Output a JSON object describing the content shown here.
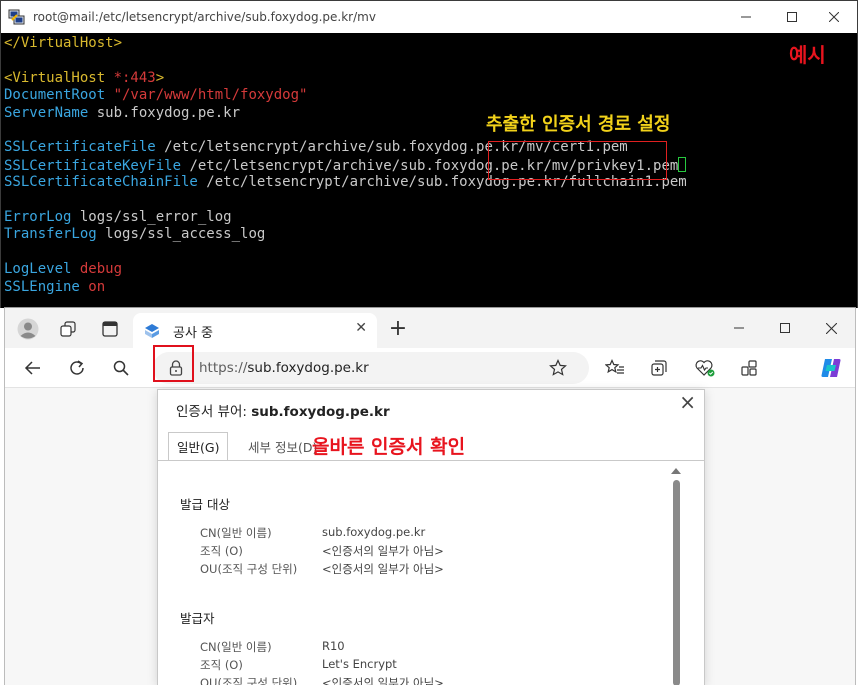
{
  "terminal": {
    "title": "root@mail:/etc/letsencrypt/archive/sub.foxydog.pe.kr/mv",
    "lines": [
      [
        {
          "t": "</VirtualHost>",
          "c": "yellow"
        }
      ],
      [],
      [
        {
          "t": "<VirtualHost ",
          "c": "yellow"
        },
        {
          "t": "*:443",
          "c": "red"
        },
        {
          "t": ">",
          "c": "yellow"
        }
      ],
      [
        {
          "t": "DocumentRoot ",
          "c": "cyan"
        },
        {
          "t": "\"/var/www/html/foxydog\"",
          "c": "red"
        }
      ],
      [
        {
          "t": "ServerName ",
          "c": "cyan"
        },
        {
          "t": "sub.foxydog.pe.kr",
          "c": "white"
        }
      ],
      [],
      [
        {
          "t": "SSLCertificateFile ",
          "c": "cyan"
        },
        {
          "t": "/etc/letsencrypt/archive/sub.foxydog.pe.kr/mv/cert1.pem",
          "c": "white"
        }
      ],
      [
        {
          "t": "SSLCertificateKeyFile ",
          "c": "cyan"
        },
        {
          "t": "/etc/letsencrypt/archive/sub.foxydog.pe.kr/mv/privkey1.pem",
          "c": "white"
        },
        {
          "cursor": true
        }
      ],
      [
        {
          "t": "SSLCertificateChainFile ",
          "c": "cyan"
        },
        {
          "t": "/etc/letsencrypt/archive/sub.foxydog.pe.kr/fullchain1.pem",
          "c": "white"
        }
      ],
      [],
      [
        {
          "t": "ErrorLog ",
          "c": "cyan"
        },
        {
          "t": "logs/ssl_error_log",
          "c": "white"
        }
      ],
      [
        {
          "t": "TransferLog ",
          "c": "cyan"
        },
        {
          "t": "logs/ssl_access_log",
          "c": "white"
        }
      ],
      [],
      [
        {
          "t": "LogLevel ",
          "c": "cyan"
        },
        {
          "t": "debug",
          "c": "red"
        }
      ],
      [
        {
          "t": "SSLEngine ",
          "c": "cyan"
        },
        {
          "t": "on",
          "c": "red"
        }
      ]
    ]
  },
  "annotations": {
    "example": "예시",
    "extract_path": "추출한 인증서 경로 설정",
    "verify_cert": "올바른 인증서 확인"
  },
  "browser": {
    "tab_title": "공사 중",
    "url_scheme": "https://",
    "url_host": "sub.foxydog.pe.kr"
  },
  "dialog": {
    "title_prefix": "인증서 뷰어: ",
    "title_host": "sub.foxydog.pe.kr",
    "tabs": [
      "일반(G)",
      "세부 정보(D)"
    ],
    "issued_to": {
      "heading": "발급 대상",
      "rows": [
        {
          "label": "CN(일반 이름)",
          "value": "sub.foxydog.pe.kr"
        },
        {
          "label": "조직 (O)",
          "value": "<인증서의 일부가 아님>"
        },
        {
          "label": "OU(조직 구성 단위)",
          "value": "<인증서의 일부가 아님>"
        }
      ]
    },
    "issued_by": {
      "heading": "발급자",
      "rows": [
        {
          "label": "CN(일반 이름)",
          "value": "R10"
        },
        {
          "label": "조직 (O)",
          "value": "Let's Encrypt"
        },
        {
          "label": "OU(조직 구성 단위)",
          "value": "<인증서의 일부가 아님>"
        }
      ]
    }
  },
  "colors": {
    "annotation_red": "#e8141e",
    "annotation_yellow": "#f2d21a",
    "terminal_cyan": "#3aa6e0",
    "terminal_yellow": "#d9b92e",
    "terminal_red": "#d53a3a"
  }
}
